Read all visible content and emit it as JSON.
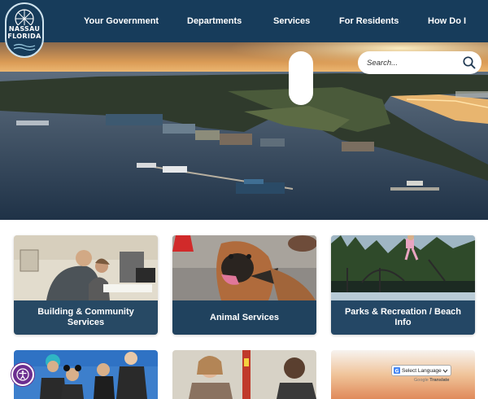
{
  "header": {
    "logo_line1": "NASSAU",
    "logo_line2": "FLORIDA",
    "nav": [
      {
        "label": "Your Government"
      },
      {
        "label": "Departments"
      },
      {
        "label": "Services"
      },
      {
        "label": "For Residents"
      },
      {
        "label": "How Do I"
      }
    ]
  },
  "search": {
    "placeholder": "Search..."
  },
  "cards": [
    {
      "label": "Building & Community Services"
    },
    {
      "label": "Animal Services"
    },
    {
      "label": "Parks & Recreation / Beach Info"
    }
  ],
  "translate": {
    "select_label": "Select Language",
    "powered_prefix": "Google",
    "powered_word": "Translate"
  },
  "icons": [
    "search-icon",
    "accessibility-icon",
    "google-g-icon",
    "chevron-down-icon"
  ],
  "colors": {
    "header_bg": "#173c5b",
    "card_label_bg": "#173c5b",
    "accessibility_bg": "#6c2e90"
  }
}
